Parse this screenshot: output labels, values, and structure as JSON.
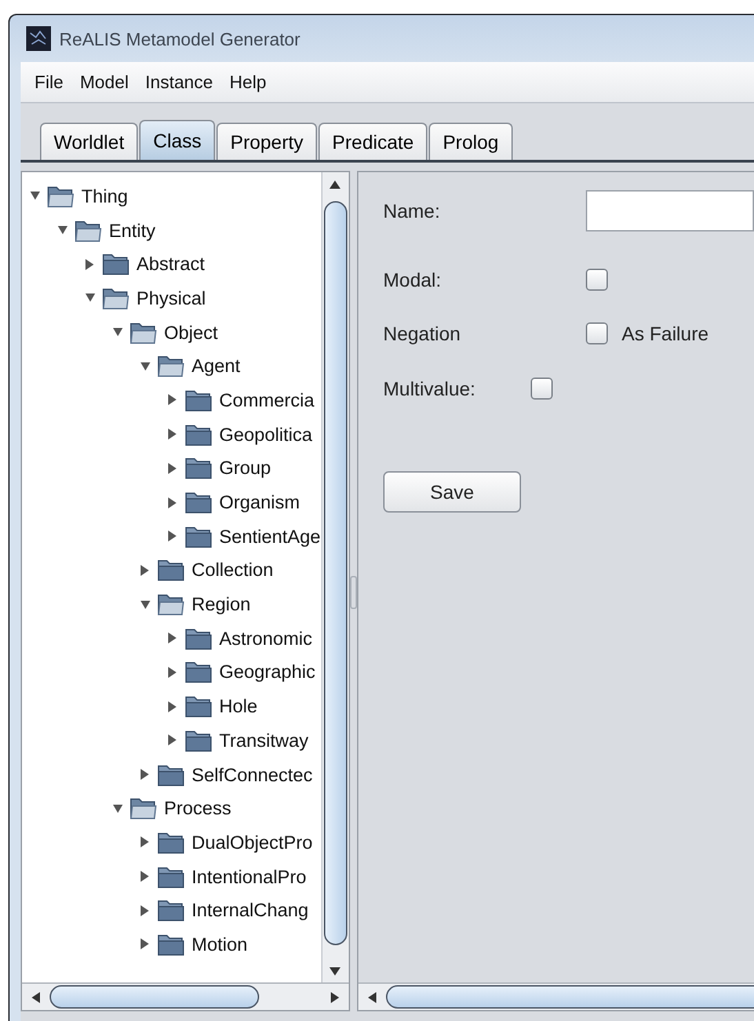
{
  "window": {
    "title": "ReALIS Metamodel Generator"
  },
  "menu": [
    "File",
    "Model",
    "Instance",
    "Help"
  ],
  "tabs": [
    {
      "label": "Worldlet",
      "selected": false
    },
    {
      "label": "Class",
      "selected": true
    },
    {
      "label": "Property",
      "selected": false
    },
    {
      "label": "Predicate",
      "selected": false
    },
    {
      "label": "Prolog",
      "selected": false
    }
  ],
  "tree": [
    {
      "label": "Thing",
      "expanded": true,
      "children": [
        {
          "label": "Entity",
          "expanded": true,
          "children": [
            {
              "label": "Abstract",
              "expanded": false
            },
            {
              "label": "Physical",
              "expanded": true,
              "children": [
                {
                  "label": "Object",
                  "expanded": true,
                  "children": [
                    {
                      "label": "Agent",
                      "expanded": true,
                      "children": [
                        {
                          "label": "Commercia",
                          "expanded": false
                        },
                        {
                          "label": "Geopolitica",
                          "expanded": false
                        },
                        {
                          "label": "Group",
                          "expanded": false
                        },
                        {
                          "label": "Organism",
                          "expanded": false
                        },
                        {
                          "label": "SentientAge",
                          "expanded": false
                        }
                      ]
                    },
                    {
                      "label": "Collection",
                      "expanded": false
                    },
                    {
                      "label": "Region",
                      "expanded": true,
                      "children": [
                        {
                          "label": "Astronomic",
                          "expanded": false
                        },
                        {
                          "label": "Geographic",
                          "expanded": false
                        },
                        {
                          "label": "Hole",
                          "expanded": false
                        },
                        {
                          "label": "Transitway",
                          "expanded": false
                        }
                      ]
                    },
                    {
                      "label": "SelfConnectec",
                      "expanded": false
                    }
                  ]
                },
                {
                  "label": "Process",
                  "expanded": true,
                  "children": [
                    {
                      "label": "DualObjectPro",
                      "expanded": false
                    },
                    {
                      "label": "IntentionalPro",
                      "expanded": false
                    },
                    {
                      "label": "InternalChang",
                      "expanded": false
                    },
                    {
                      "label": "Motion",
                      "expanded": false
                    }
                  ]
                }
              ]
            }
          ]
        }
      ]
    }
  ],
  "form": {
    "name_label": "Name:",
    "modal": {
      "label": "Modal:",
      "checked": false
    },
    "negation": {
      "label": "Negation",
      "checked": false,
      "option": "As Failure"
    },
    "multivalue": {
      "label": "Multivalue:",
      "checked": false
    },
    "save": "Save"
  }
}
